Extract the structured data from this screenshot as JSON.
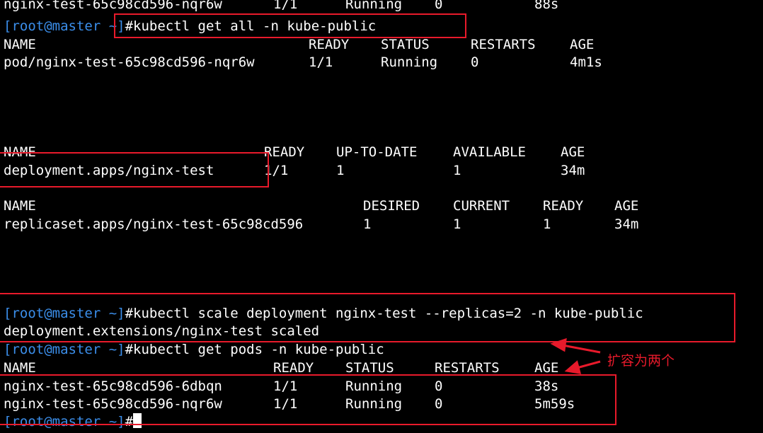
{
  "colors": {
    "background": "#000000",
    "prompt": "#3b8eea",
    "text": "#ffffff",
    "highlight": "#e81a2b"
  },
  "prev_line": {
    "name": "nginx-test-65c98cd596-nqr6w",
    "ready": "1/1",
    "status": "Running",
    "restarts": "0",
    "age": "88s"
  },
  "cmd1": {
    "prompt": "[root@master ~]",
    "text": "#kubectl get all -n kube-public"
  },
  "pods_table": {
    "headers": [
      "NAME",
      "READY",
      "STATUS",
      "RESTARTS",
      "AGE"
    ],
    "rows": [
      [
        "pod/nginx-test-65c98cd596-nqr6w",
        "1/1",
        "Running",
        "0",
        "4m1s"
      ]
    ]
  },
  "deploy_table": {
    "headers": [
      "NAME",
      "READY",
      "UP-TO-DATE",
      "AVAILABLE",
      "AGE"
    ],
    "rows": [
      [
        "deployment.apps/nginx-test",
        "1/1",
        "1",
        "1",
        "34m"
      ]
    ]
  },
  "rs_table": {
    "headers": [
      "NAME",
      "DESIRED",
      "CURRENT",
      "READY",
      "AGE"
    ],
    "rows": [
      [
        "replicaset.apps/nginx-test-65c98cd596",
        "1",
        "1",
        "1",
        "34m"
      ]
    ]
  },
  "cmd2": {
    "prompt": "[root@master ~]",
    "text": "#kubectl scale deployment nginx-test --replicas=2 -n kube-public",
    "output": "deployment.extensions/nginx-test scaled"
  },
  "cmd3": {
    "prompt": "[root@master ~]",
    "text": "#kubectl get pods -n kube-public"
  },
  "pods2_table": {
    "headers": [
      "NAME",
      "READY",
      "STATUS",
      "RESTARTS",
      "AGE"
    ],
    "rows": [
      [
        "nginx-test-65c98cd596-6dbqn",
        "1/1",
        "Running",
        "0",
        "38s"
      ],
      [
        "nginx-test-65c98cd596-nqr6w",
        "1/1",
        "Running",
        "0",
        "5m59s"
      ]
    ]
  },
  "final_prompt": {
    "prompt": "[root@master ~]",
    "text": "#"
  },
  "annotation": {
    "text": "扩容为两个"
  }
}
